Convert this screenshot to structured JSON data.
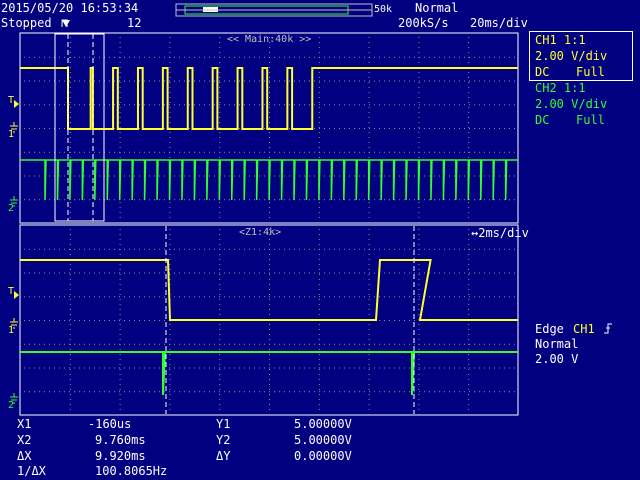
{
  "header": {
    "datetime": "2015/05/20 16:53:34",
    "status": "Stopped",
    "trigger_symbol": "⊓",
    "record_count": "12",
    "scale_right": "50k",
    "trigger_mode": "Normal",
    "sample_rate": "200kS/s",
    "timebase": "20ms/div"
  },
  "main_window": {
    "label": "<< Main:40k >>"
  },
  "zoom_window": {
    "label": "<Z1:4k>",
    "timebase": "↔2ms/div"
  },
  "channels": {
    "ch1": {
      "title": "CH1 1:1",
      "volts": "2.00 V/div",
      "coupling": "DC",
      "bandwidth": "Full"
    },
    "ch2": {
      "title": "CH2 1:1",
      "volts": "2.00 V/div",
      "coupling": "DC",
      "bandwidth": "Full"
    }
  },
  "trigger": {
    "type": "Edge",
    "source": "CH1",
    "slope_icon": "rising-edge-icon",
    "mode": "Normal",
    "level": "2.00 V"
  },
  "markers": {
    "trigger_level_icon": "T",
    "ground_icon": "ground-icon",
    "marker_1": "1",
    "marker_2": "2"
  },
  "cursors": {
    "x1_label": "X1",
    "x1_value": "-160us",
    "x2_label": "X2",
    "x2_value": "9.760ms",
    "dx_label": "ΔX",
    "dx_value": "9.920ms",
    "inv_dx_label": "1/ΔX",
    "inv_dx_value": "100.8065Hz",
    "y1_label": "Y1",
    "y1_value": "5.00000V",
    "y2_label": "Y2",
    "y2_value": "5.00000V",
    "dy_label": "ΔY",
    "dy_value": "0.00000V"
  },
  "colors": {
    "background": "#000080",
    "ch1": "#ffff30",
    "ch2": "#30ff30",
    "grid": "#c0c0c0",
    "text": "#ffffff"
  },
  "waveforms": {
    "main_ch1_pulse_high_fractions": [
      0.09,
      0.19,
      0.19,
      0.19,
      0.19,
      0.19,
      0.19,
      0.19,
      0.19,
      0.19
    ],
    "main_ch1_pulse_period_divs": 0.5,
    "main_ch2_spike_period_divs": 0.25,
    "zoom_ch1_high_start_div": 7.1
  }
}
